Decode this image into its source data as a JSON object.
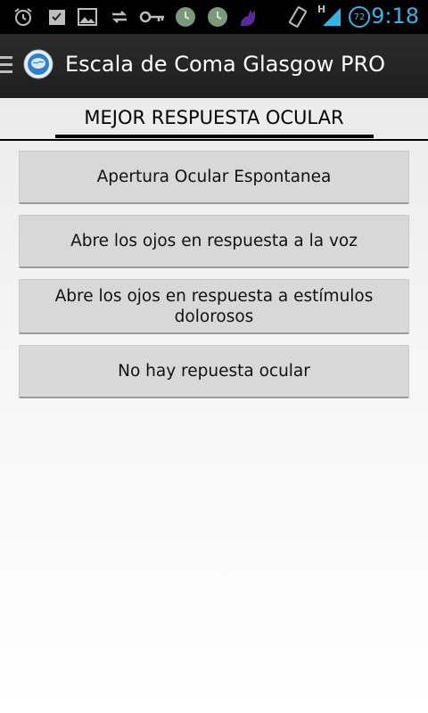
{
  "status_bar": {
    "time": "9:18",
    "battery_level": "72",
    "network_label": "H",
    "icons": [
      "alarm-icon",
      "checkbox-icon",
      "image-icon",
      "sync-icon",
      "key-icon",
      "clock-icon",
      "clock-icon",
      "cat-icon",
      "vibrate-icon",
      "signal-icon",
      "battery-icon"
    ]
  },
  "action_bar": {
    "title": "Escala de Coma Glasgow PRO",
    "icons": [
      "drawer-icon",
      "app-logo-icon"
    ]
  },
  "section": {
    "title": "MEJOR RESPUESTA OCULAR"
  },
  "options": [
    {
      "label": "Apertura Ocular Espontanea"
    },
    {
      "label": "Abre los ojos en respuesta a la voz"
    },
    {
      "label": "Abre los ojos en respuesta a estímulos dolorosos"
    },
    {
      "label": "No hay repuesta ocular"
    }
  ],
  "colors": {
    "status_accent": "#33b5e5",
    "action_bar": "#222222",
    "button_bg": "#d8d8d8"
  }
}
